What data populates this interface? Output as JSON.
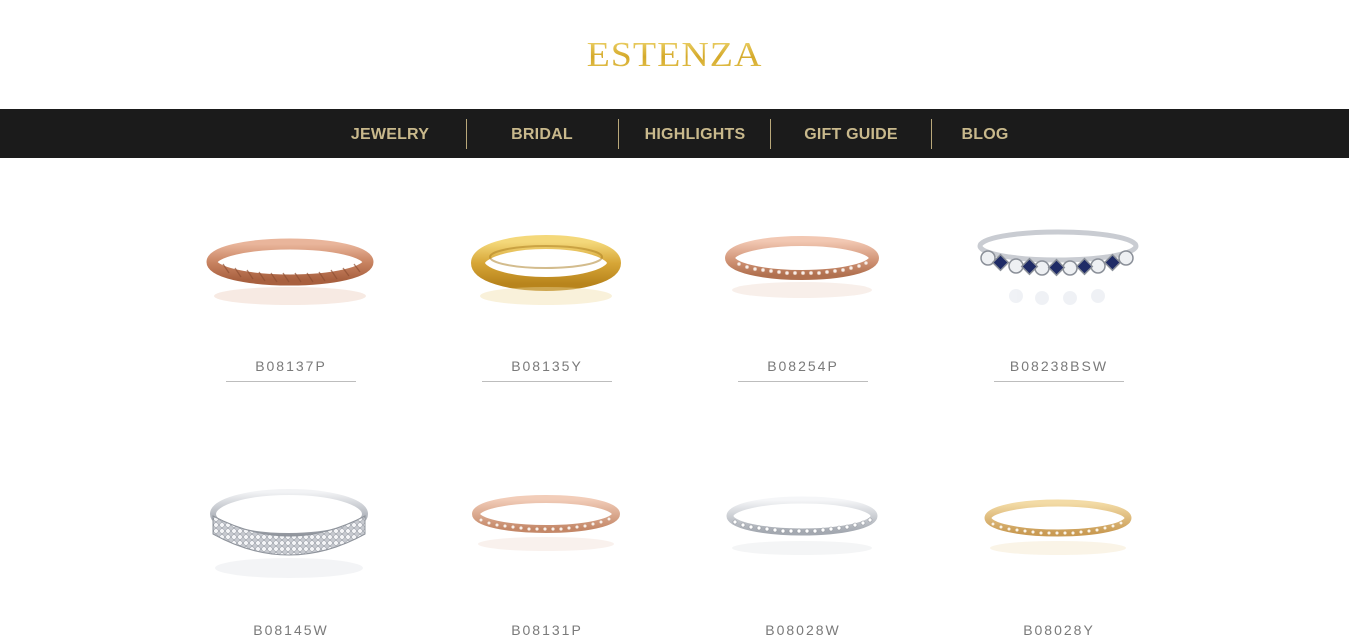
{
  "brand": {
    "logo_text": "ESTENZA"
  },
  "nav": {
    "items": [
      {
        "label": "JEWELRY"
      },
      {
        "label": "BRIDAL"
      },
      {
        "label": "HIGHLIGHTS"
      },
      {
        "label": "GIFT GUIDE"
      },
      {
        "label": "BLOG"
      }
    ]
  },
  "products": [
    {
      "sku": "B08137P",
      "metal": "rose-gold",
      "style": "twisted-rope-band"
    },
    {
      "sku": "B08135Y",
      "metal": "yellow-gold",
      "style": "plain-dome-band"
    },
    {
      "sku": "B08254P",
      "metal": "rose-gold",
      "style": "pave-eternity-band"
    },
    {
      "sku": "B08238BSW",
      "metal": "white-gold",
      "style": "sapphire-diamond-bezel-band"
    },
    {
      "sku": "B08145W",
      "metal": "white-gold",
      "style": "wide-pave-dome-band"
    },
    {
      "sku": "B08131P",
      "metal": "rose-gold",
      "style": "double-row-pave-band"
    },
    {
      "sku": "B08028W",
      "metal": "white-gold",
      "style": "thin-pave-band"
    },
    {
      "sku": "B08028Y",
      "metal": "yellow-gold",
      "style": "thin-pave-band"
    }
  ],
  "colors": {
    "nav_bg": "#1b1b1b",
    "nav_text": "#c9b98c",
    "logo_gold": "#d8b93c",
    "sku_text": "#7a7a7a"
  }
}
